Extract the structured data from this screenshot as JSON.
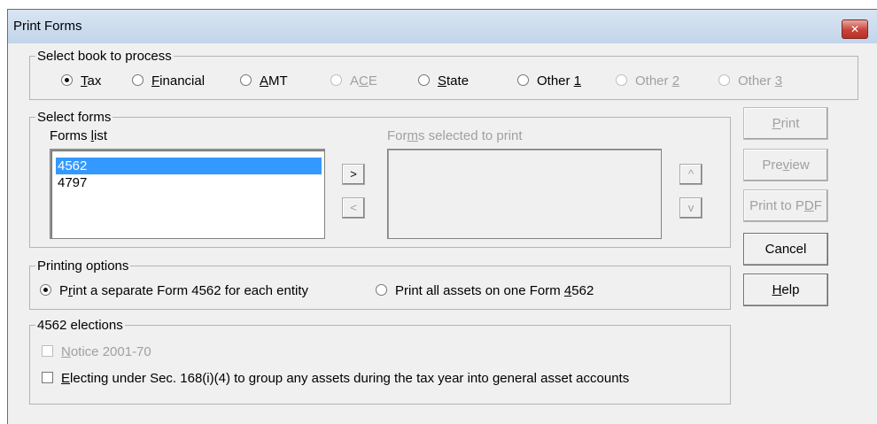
{
  "window": {
    "title": "Print Forms",
    "close_glyph": "✕"
  },
  "book": {
    "legend": "Select book to process",
    "options": [
      {
        "pre": "",
        "u": "T",
        "post": "ax",
        "checked": true,
        "disabled": false
      },
      {
        "pre": "",
        "u": "F",
        "post": "inancial",
        "checked": false,
        "disabled": false
      },
      {
        "pre": "",
        "u": "A",
        "post": "MT",
        "checked": false,
        "disabled": false
      },
      {
        "pre": "A",
        "u": "C",
        "post": "E",
        "checked": false,
        "disabled": true
      },
      {
        "pre": "",
        "u": "S",
        "post": "tate",
        "checked": false,
        "disabled": false
      },
      {
        "pre": "Other ",
        "u": "1",
        "post": "",
        "checked": false,
        "disabled": false
      },
      {
        "pre": "Other ",
        "u": "2",
        "post": "",
        "checked": false,
        "disabled": true
      },
      {
        "pre": "Other ",
        "u": "3",
        "post": "",
        "checked": false,
        "disabled": true
      }
    ]
  },
  "forms": {
    "legend": "Select forms",
    "list_label": {
      "pre": "Forms ",
      "u": "l",
      "post": "ist"
    },
    "selected_label": {
      "pre": "For",
      "u": "m",
      "post": "s selected to print"
    },
    "list_items": [
      "4562",
      "4797"
    ],
    "selected_index": 0,
    "add_glyph": ">",
    "remove_glyph": "<",
    "up_glyph": "^",
    "down_glyph": "v"
  },
  "buttons": {
    "print": {
      "pre": "",
      "u": "P",
      "post": "rint",
      "disabled": true
    },
    "preview": {
      "pre": "Pre",
      "u": "v",
      "post": "iew",
      "disabled": true
    },
    "pdf": {
      "pre": "Print to P",
      "u": "D",
      "post": "F",
      "disabled": true
    },
    "cancel": {
      "pre": "Cancel",
      "u": "",
      "post": "",
      "disabled": false
    },
    "help": {
      "pre": "",
      "u": "H",
      "post": "elp",
      "disabled": false
    }
  },
  "printing": {
    "legend": "Printing options",
    "opt1": {
      "pre": "P",
      "u": "r",
      "post": "int a separate Form 4562 for each entity",
      "checked": true
    },
    "opt2": {
      "pre": "Print all assets on one Form ",
      "u": "4",
      "post": "562",
      "checked": false
    }
  },
  "elections": {
    "legend": "4562 elections",
    "notice": {
      "pre": "",
      "u": "N",
      "post": "otice 2001-70",
      "checked": false,
      "disabled": true
    },
    "electing": {
      "pre": "",
      "u": "E",
      "post": "lecting under Sec. 168(i)(4) to group any assets during the tax year into general asset accounts",
      "checked": false,
      "disabled": false
    }
  }
}
